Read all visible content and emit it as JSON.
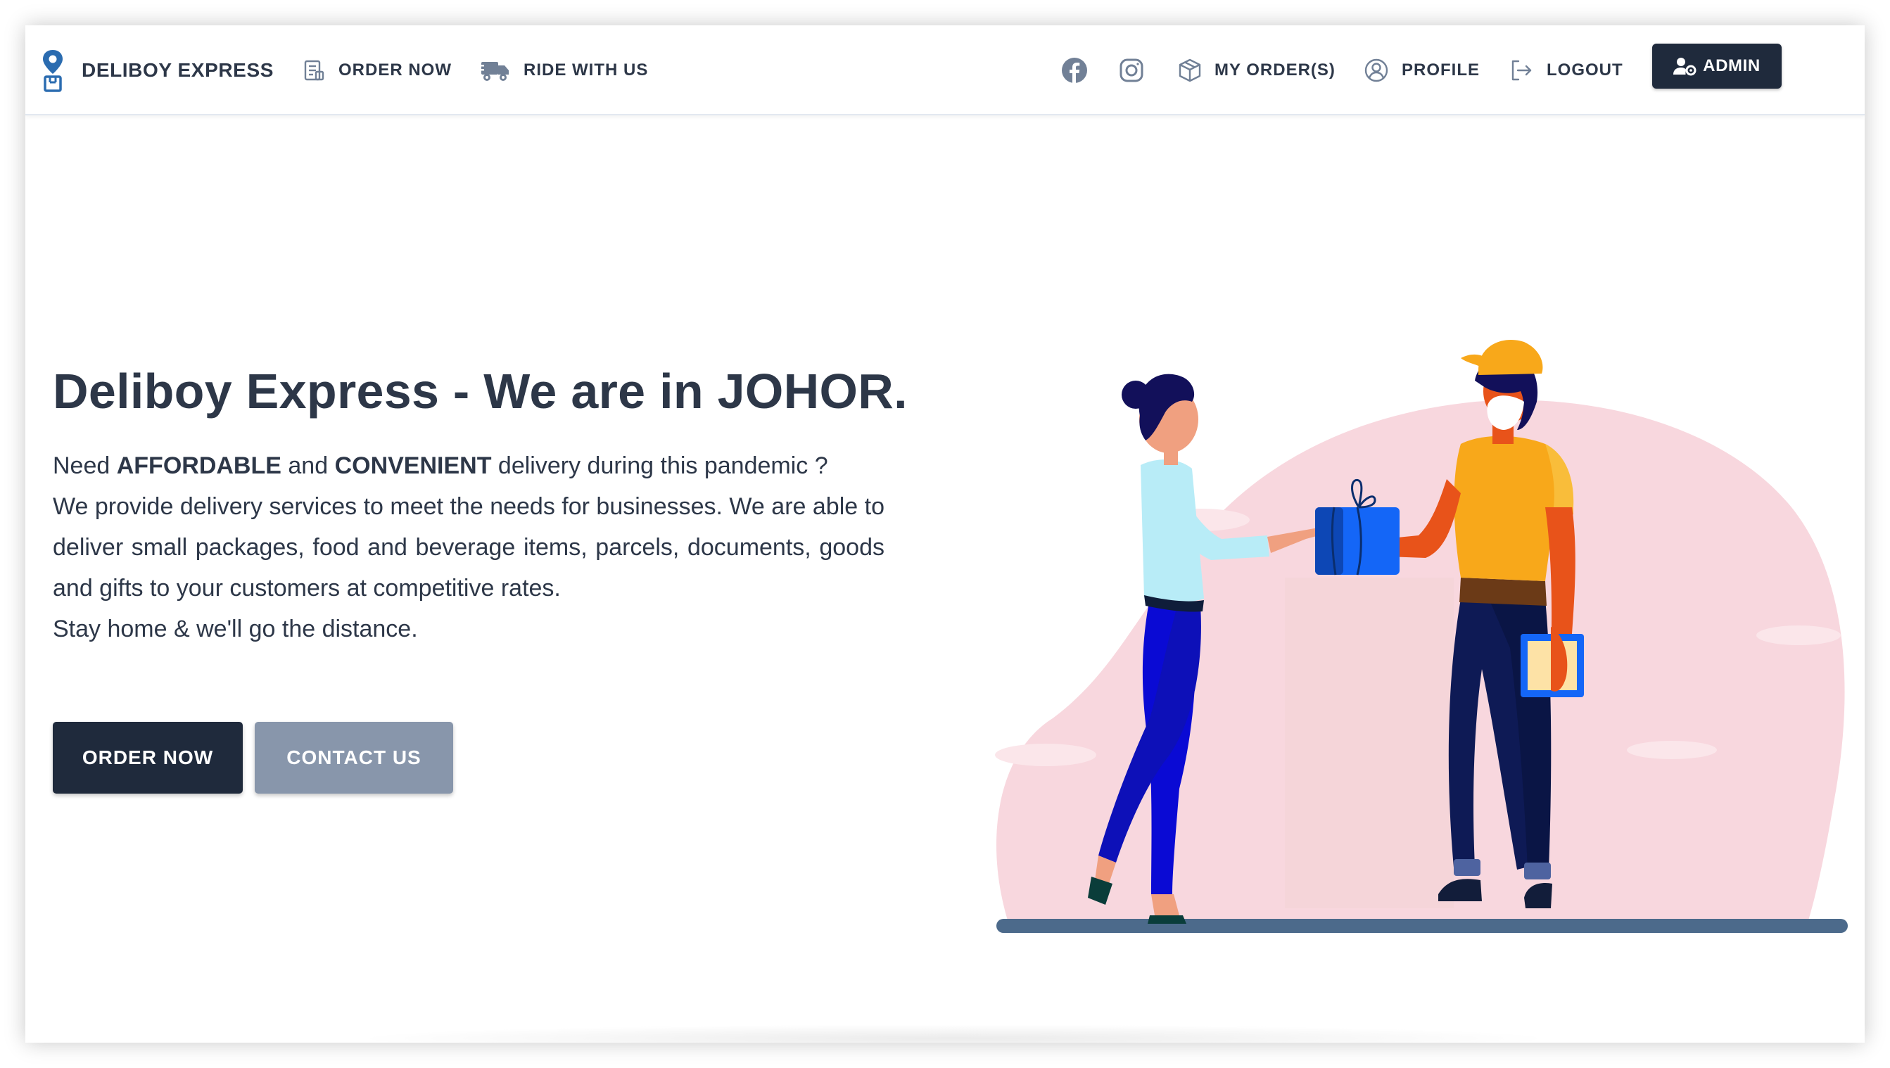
{
  "navbar": {
    "brand": "DELIBOY EXPRESS",
    "links": {
      "order_now": "ORDER NOW",
      "ride_with_us": "RIDE WITH US",
      "my_orders": "MY ORDER(S)",
      "profile": "PROFILE",
      "logout": "LOGOUT"
    },
    "social": [
      "facebook-icon",
      "instagram-icon"
    ],
    "admin_label": "ADMIN"
  },
  "hero": {
    "title": "Deliboy Express - We are in JOHOR.",
    "line1": {
      "prefix": "Need ",
      "bold1": "AFFORDABLE",
      "middle": " and ",
      "bold2": "CONVENIENT",
      "suffix": " delivery during this pandemic ?"
    },
    "paragraph": "We provide delivery services to meet the needs for businesses. We are able to deliver small packages, food and beverage items, parcels, documents, goods and gifts to your customers at competitive rates.",
    "closing": "Stay home & we'll go the distance.",
    "primary_button": "ORDER NOW",
    "secondary_button": "CONTACT US"
  },
  "colors": {
    "dark": "#1f2a3c",
    "secondary_button": "#8896ab",
    "accent_blue": "#2b6cb0",
    "illustration_pink": "#f8d7de"
  }
}
